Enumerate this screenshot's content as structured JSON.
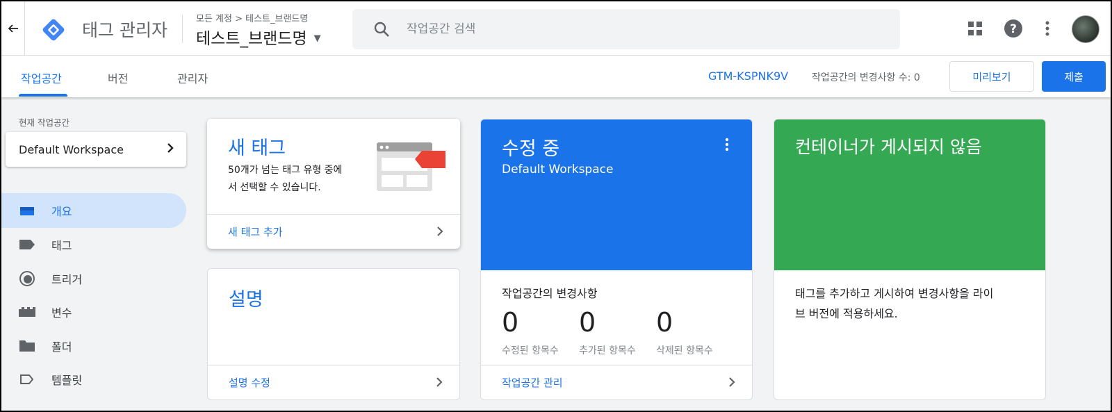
{
  "header": {
    "app_title": "태그 관리자",
    "breadcrumb": "모든 계정 > 테스트_브랜드명",
    "account_name": "테스트_브랜드명",
    "search_placeholder": "작업공간 검색"
  },
  "subnav": {
    "tabs": [
      {
        "label": "작업공간",
        "active": true
      },
      {
        "label": "버전",
        "active": false
      },
      {
        "label": "관리자",
        "active": false
      }
    ],
    "container_id": "GTM-KSPNK9V",
    "changes_text": "작업공간의 변경사항 수: 0",
    "preview_label": "미리보기",
    "submit_label": "제출"
  },
  "sidebar": {
    "workspace_label": "현재 작업공간",
    "workspace_name": "Default Workspace",
    "items": [
      {
        "label": "개요",
        "icon": "overview-icon",
        "active": true
      },
      {
        "label": "태그",
        "icon": "tag-icon",
        "active": false
      },
      {
        "label": "트리거",
        "icon": "trigger-icon",
        "active": false
      },
      {
        "label": "변수",
        "icon": "variable-icon",
        "active": false
      },
      {
        "label": "폴더",
        "icon": "folder-icon",
        "active": false
      },
      {
        "label": "템플릿",
        "icon": "template-icon",
        "active": false
      }
    ]
  },
  "cards": {
    "new_tag": {
      "title": "새 태그",
      "desc_line1": "50개가 넘는 태그 유형 중에",
      "desc_line2": "서 선택할 수 있습니다.",
      "link": "새 태그 추가"
    },
    "description": {
      "title": "설명",
      "link": "설명 수정"
    },
    "editing": {
      "title": "수정 중",
      "subtitle": "Default Workspace",
      "changes_title": "작업공간의 변경사항",
      "stats": [
        {
          "value": "0",
          "label": "수정된 항목수"
        },
        {
          "value": "0",
          "label": "추가된 항목수"
        },
        {
          "value": "0",
          "label": "삭제된 항목수"
        }
      ],
      "link": "작업공간 관리",
      "color": "#1a73e8"
    },
    "not_published": {
      "title": "컨테이너가 게시되지 않음",
      "desc_line1": "태그를 추가하고 게시하여 변경사항을 라이",
      "desc_line2": "브 버전에 적용하세요.",
      "color": "#34a853"
    }
  }
}
